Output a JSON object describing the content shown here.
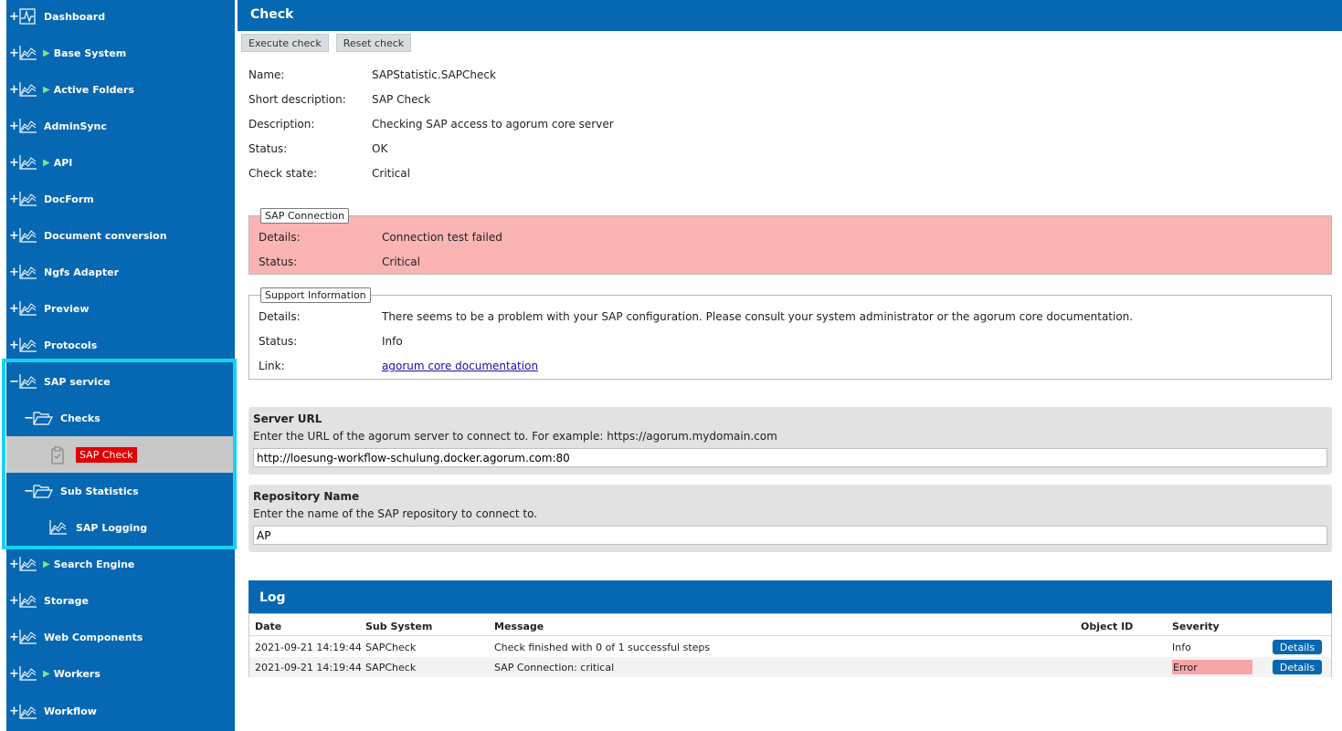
{
  "sidebar": {
    "items": [
      {
        "label": "Dashboard",
        "toggle": "+",
        "icon": "dashboard-chart-icon",
        "arrow": false
      },
      {
        "label": "Base System",
        "toggle": "+",
        "icon": "chart-icon",
        "arrow": true
      },
      {
        "label": "Active Folders",
        "toggle": "+",
        "icon": "chart-icon",
        "arrow": true
      },
      {
        "label": "AdminSync",
        "toggle": "+",
        "icon": "chart-icon",
        "arrow": false
      },
      {
        "label": "API",
        "toggle": "+",
        "icon": "chart-icon",
        "arrow": true
      },
      {
        "label": "DocForm",
        "toggle": "+",
        "icon": "chart-icon",
        "arrow": false
      },
      {
        "label": "Document conversion",
        "toggle": "+",
        "icon": "chart-icon",
        "arrow": false
      },
      {
        "label": "Ngfs Adapter",
        "toggle": "+",
        "icon": "chart-icon",
        "arrow": false
      },
      {
        "label": "Preview",
        "toggle": "+",
        "icon": "chart-icon",
        "arrow": false
      },
      {
        "label": "Protocols",
        "toggle": "+",
        "icon": "chart-icon",
        "arrow": false
      },
      {
        "label": "SAP service",
        "toggle": "−",
        "icon": "chart-icon",
        "arrow": false
      },
      {
        "label": "Checks",
        "toggle": "−",
        "icon": "folder-open-icon",
        "arrow": false
      },
      {
        "label": "SAP Check",
        "toggle": "",
        "icon": "clipboard-check-icon",
        "arrow": false
      },
      {
        "label": "Sub Statistics",
        "toggle": "−",
        "icon": "folder-open-icon",
        "arrow": false
      },
      {
        "label": "SAP Logging",
        "toggle": "",
        "icon": "chart-icon",
        "arrow": false
      },
      {
        "label": "Search Engine",
        "toggle": "+",
        "icon": "chart-icon",
        "arrow": true
      },
      {
        "label": "Storage",
        "toggle": "+",
        "icon": "chart-icon",
        "arrow": false
      },
      {
        "label": "Web Components",
        "toggle": "+",
        "icon": "chart-icon",
        "arrow": false
      },
      {
        "label": "Workers",
        "toggle": "+",
        "icon": "chart-icon",
        "arrow": true
      },
      {
        "label": "Workflow",
        "toggle": "+",
        "icon": "chart-icon",
        "arrow": false
      }
    ]
  },
  "header": {
    "title": "Check"
  },
  "toolbar": {
    "execute_label": "Execute check",
    "reset_label": "Reset check"
  },
  "check": {
    "name_label": "Name:",
    "name": "SAPStatistic.SAPCheck",
    "short_label": "Short description:",
    "short": "SAP Check",
    "desc_label": "Description:",
    "desc": "Checking SAP access to agorum core server",
    "status_label": "Status:",
    "status": "OK",
    "state_label": "Check state:",
    "state": "Critical"
  },
  "sap_connection": {
    "legend": "SAP Connection",
    "details_label": "Details:",
    "details": "Connection test failed",
    "status_label": "Status:",
    "status": "Critical",
    "bg_color": "#fbb4b4"
  },
  "support": {
    "legend": "Support Information",
    "details_label": "Details:",
    "details": "There seems to be a problem with your SAP configuration. Please consult your system administrator or the agorum core documentation.",
    "status_label": "Status:",
    "status": "Info",
    "link_label": "Link:",
    "link_text": "agorum core documentation"
  },
  "server_url": {
    "title": "Server URL",
    "desc": "Enter the URL of the agorum server to connect to. For example: https://agorum.mydomain.com",
    "value": "http://loesung-workflow-schulung.docker.agorum.com:80"
  },
  "repository": {
    "title": "Repository Name",
    "desc": "Enter the name of the SAP repository to connect to.",
    "value": "AP"
  },
  "log": {
    "title": "Log",
    "columns": [
      "Date",
      "Sub System",
      "Message",
      "Object ID",
      "Severity"
    ],
    "rows": [
      {
        "date": "2021-09-21 14:19:44",
        "sub": "SAPCheck",
        "msg": "Check finished with 0 of 1 successful steps",
        "obj": "",
        "sev": "Info",
        "btn": "Details"
      },
      {
        "date": "2021-09-21 14:19:44",
        "sub": "SAPCheck",
        "msg": "SAP Connection: critical",
        "obj": "",
        "sev": "Error",
        "btn": "Details"
      }
    ]
  },
  "colors": {
    "brand": "#0667b3",
    "highlight": "#14d3f2",
    "error": "#e00000"
  }
}
